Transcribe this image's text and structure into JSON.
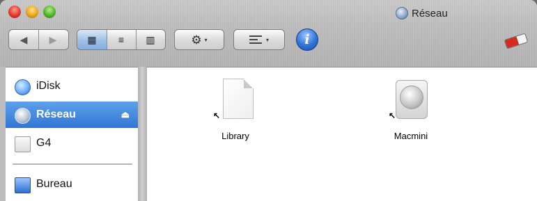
{
  "window": {
    "title": "Réseau",
    "controls": [
      "close",
      "minimize",
      "zoom"
    ]
  },
  "toolbar": {
    "back_glyph": "◀",
    "forward_glyph": "▶",
    "view_icons_glyph": "▦",
    "view_list_glyph": "≡",
    "view_columns_glyph": "▥",
    "action_glyph": "⚙",
    "caret": "▾",
    "info_glyph": "i",
    "icons": {
      "back": "back-arrow-icon",
      "forward": "forward-arrow-icon",
      "icon_view": "icon-view-icon",
      "list_view": "list-view-icon",
      "column_view": "column-view-icon",
      "action": "gear-icon",
      "arrange": "arrange-icon",
      "info": "info-icon",
      "eraser": "eraser-icon"
    }
  },
  "sidebar": {
    "items": [
      {
        "label": "iDisk",
        "icon": "idisk-icon",
        "selected": false
      },
      {
        "label": "Réseau",
        "icon": "network-globe-icon",
        "selected": true,
        "eject": "⏏"
      },
      {
        "label": "G4",
        "icon": "hard-drive-icon",
        "selected": false
      },
      {
        "label": "Bureau",
        "icon": "desktop-icon",
        "selected": false
      }
    ]
  },
  "main": {
    "files": [
      {
        "label": "Library",
        "icon": "document-alias-icon"
      },
      {
        "label": "Macmini",
        "icon": "server-alias-icon"
      }
    ],
    "alias_arrow": "↖"
  },
  "colors": {
    "selection": "#2f77d4",
    "window_chrome": "#bdbdbd",
    "info_button": "#2f74d8"
  }
}
